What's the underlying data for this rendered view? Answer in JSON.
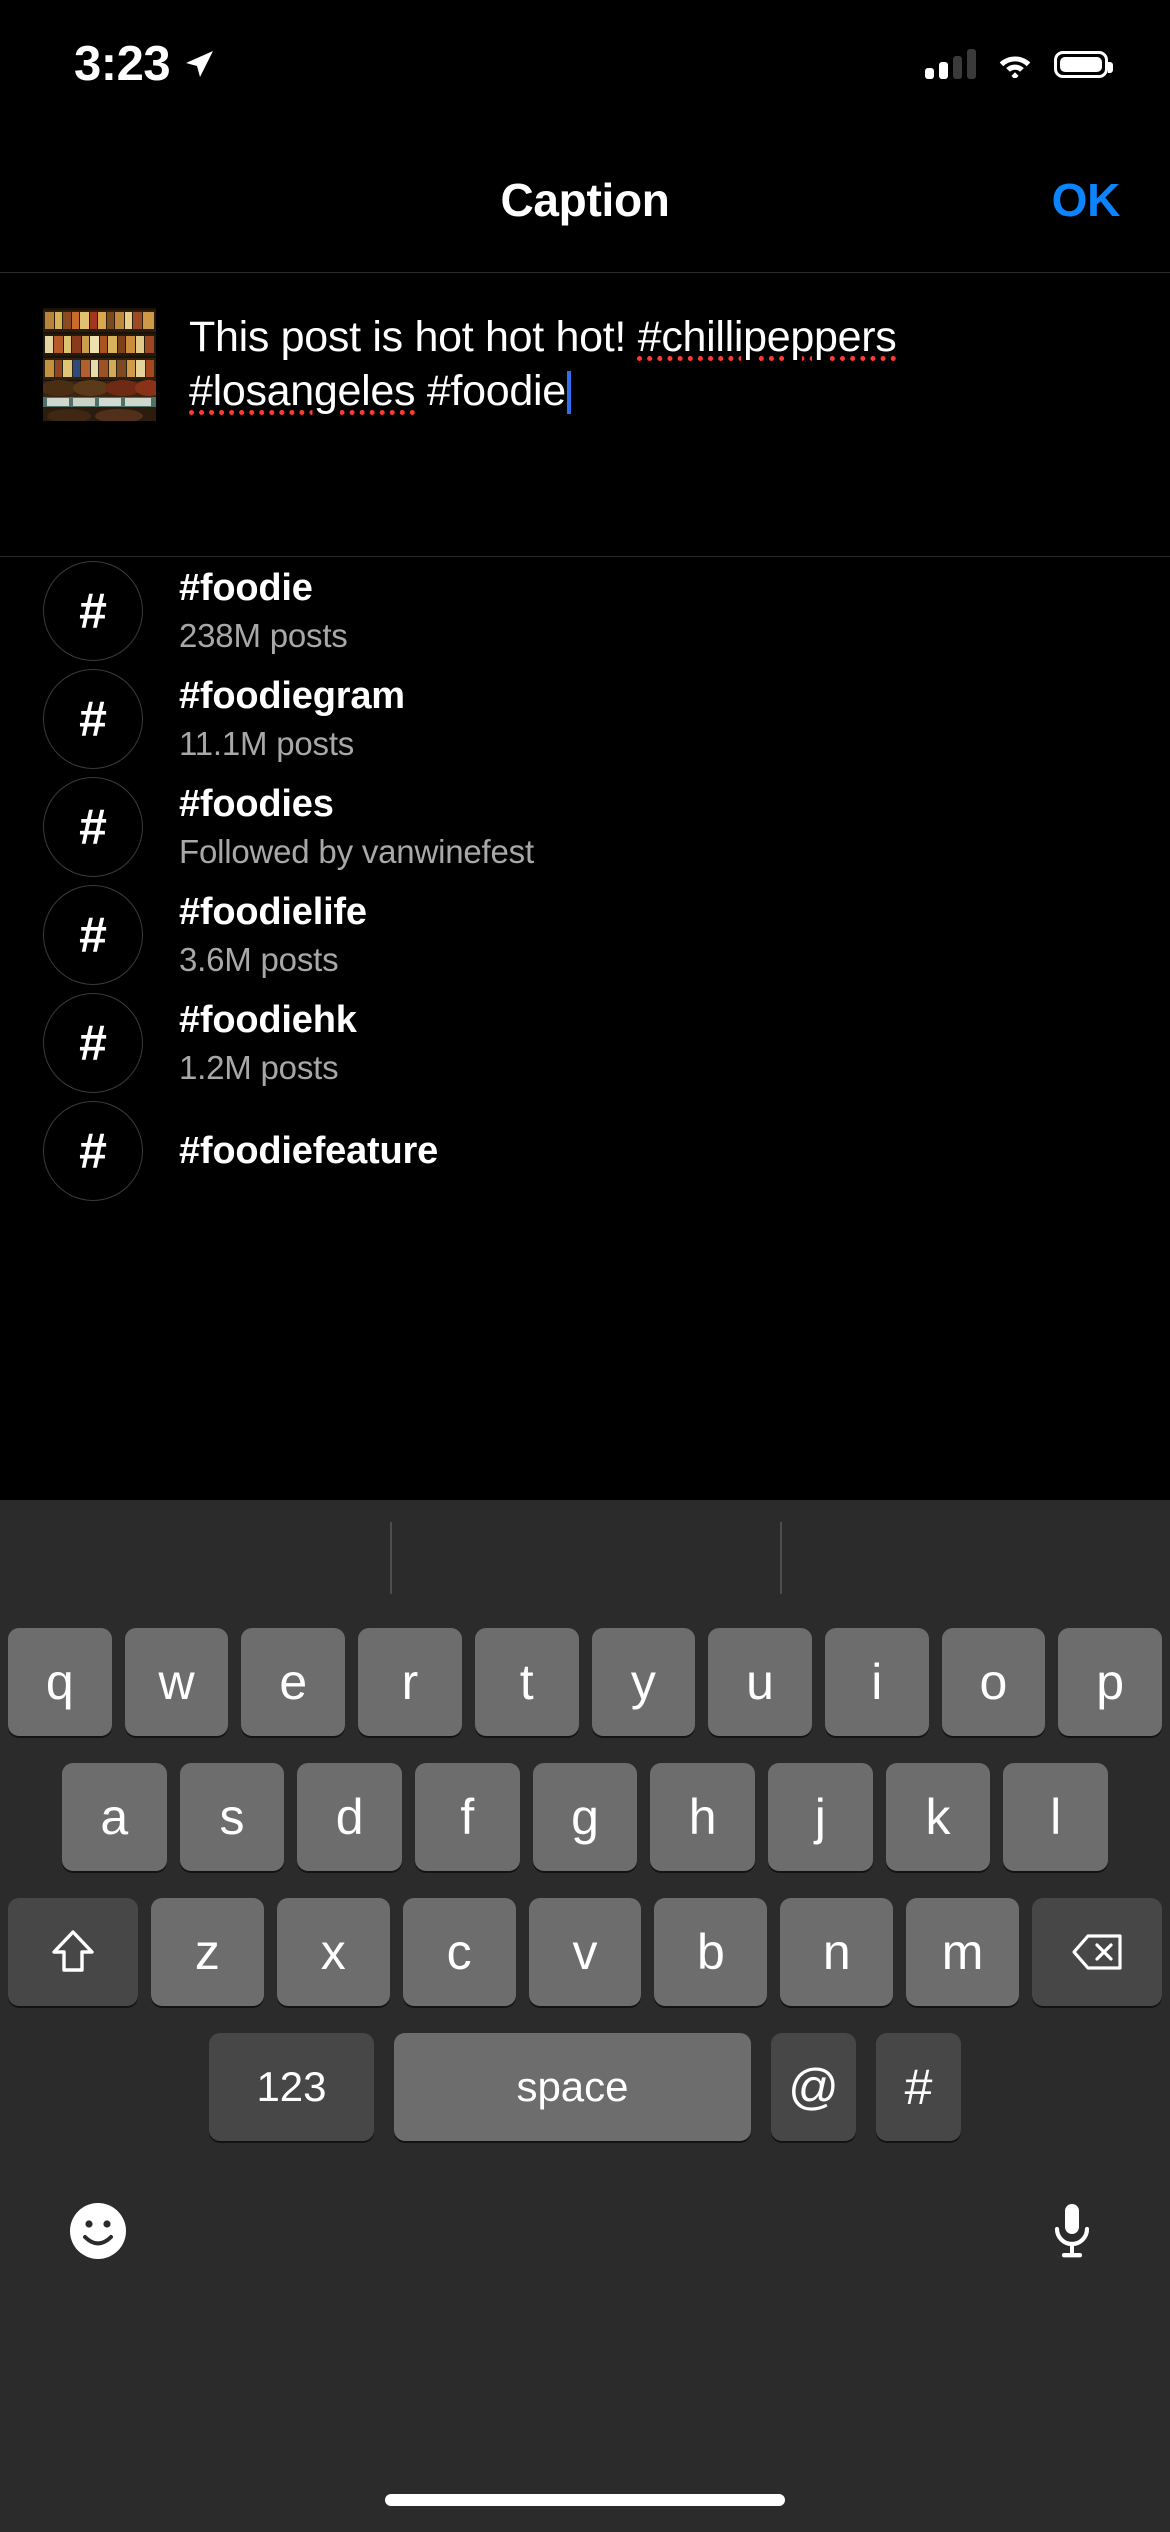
{
  "status_bar": {
    "time": "3:23",
    "location_icon": "location-arrow-icon",
    "signal_icon": "cellular-signal-icon",
    "wifi_icon": "wifi-icon",
    "battery_icon": "battery-full-icon"
  },
  "nav": {
    "title": "Caption",
    "ok_label": "OK",
    "ok_color": "#0A84FF"
  },
  "caption": {
    "thumbnail_alt": "post-thumbnail",
    "text_plain": "This post is hot hot hot! #chillipeppers #losangeles #foodie",
    "segment_1": "This post is hot hot hot! ",
    "segment_2": "#chillipeppers",
    "segment_3": " ",
    "segment_4": "#losangeles",
    "segment_5": " #foodie",
    "misspell_underline_color": "#ff3b30",
    "caret_color": "#2f6fed"
  },
  "hashtag_suggestions": [
    {
      "icon": "#",
      "name": "#foodie",
      "sub": "238M posts"
    },
    {
      "icon": "#",
      "name": "#foodiegram",
      "sub": "11.1M posts"
    },
    {
      "icon": "#",
      "name": "#foodies",
      "sub": "Followed by vanwinefest"
    },
    {
      "icon": "#",
      "name": "#foodielife",
      "sub": "3.6M posts"
    },
    {
      "icon": "#",
      "name": "#foodiehk",
      "sub": "1.2M posts"
    },
    {
      "icon": "#",
      "name": "#foodiefeature",
      "sub": ""
    }
  ],
  "keyboard": {
    "row1": [
      "q",
      "w",
      "e",
      "r",
      "t",
      "y",
      "u",
      "i",
      "o",
      "p"
    ],
    "row2": [
      "a",
      "s",
      "d",
      "f",
      "g",
      "h",
      "j",
      "k",
      "l"
    ],
    "row3": [
      "z",
      "x",
      "c",
      "v",
      "b",
      "n",
      "m"
    ],
    "shift_key": "shift-key",
    "delete_key": "delete-key",
    "numeric_label": "123",
    "space_label": "space",
    "at_label": "@",
    "hash_label": "#",
    "emoji_icon": "emoji-smiley-icon",
    "mic_icon": "microphone-icon",
    "key_color": "#6d6d6d",
    "modifier_key_color": "#474747",
    "background_color": "#2b2b2b"
  }
}
